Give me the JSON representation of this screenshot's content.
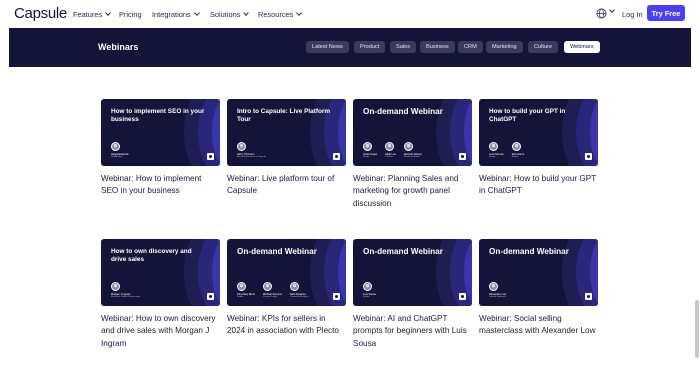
{
  "nav": {
    "logo": "Capsule",
    "items": [
      {
        "label": "Features",
        "dropdown": true
      },
      {
        "label": "Pricing",
        "dropdown": false
      },
      {
        "label": "Integrations",
        "dropdown": true
      },
      {
        "label": "Solutions",
        "dropdown": true
      },
      {
        "label": "Resources",
        "dropdown": true
      }
    ],
    "language_icon": "globe-icon",
    "login": "Log In",
    "cta": "Try Free",
    "cta_color": "#4b3ff0"
  },
  "header": {
    "title": "Webinars",
    "background": "#14143a",
    "categories": [
      {
        "label": "Latest News",
        "active": false
      },
      {
        "label": "Product",
        "active": false
      },
      {
        "label": "Sales",
        "active": false
      },
      {
        "label": "Business",
        "active": false
      },
      {
        "label": "CRM",
        "active": false
      },
      {
        "label": "Marketing",
        "active": false
      },
      {
        "label": "Culture",
        "active": false
      },
      {
        "label": "Webinars",
        "active": true
      }
    ]
  },
  "webinars": [
    {
      "thumb_title": "How to implement SEO in your business",
      "speakers": [
        {
          "name": "Helga Edwards",
          "role": "Studio Host"
        }
      ],
      "caption": "Webinar: How to implement SEO in your business"
    },
    {
      "thumb_title": "Intro to Capsule: Live Platform Tour",
      "speakers": [
        {
          "name": "Harry Thornton",
          "role": "Account Executive at Capsule"
        }
      ],
      "caption": "Webinar: Live platform tour of Capsule"
    },
    {
      "thumb_title": "On-demand Webinar",
      "speakers": [
        {
          "name": "Asher Kogin",
          "role": "Studio"
        },
        {
          "name": "Nikki Lou",
          "role": "Content"
        },
        {
          "name": "Hannah Gibson",
          "role": "Research Author"
        }
      ],
      "caption": "Webinar: Planning Sales and marketing for growth panel discussion"
    },
    {
      "thumb_title": "How to build your GPT in ChatGPT",
      "speakers": [
        {
          "name": "Luis Norman",
          "role": "Studio"
        },
        {
          "name": "Rob Harris",
          "role": "Studio"
        }
      ],
      "caption": "Webinar: How to build your GPT in ChatGPT"
    },
    {
      "thumb_title": "How to own discovery and drive sales",
      "speakers": [
        {
          "name": "Morgan J Ingram",
          "role": "Executive Global Partnerships"
        }
      ],
      "caption": "Webinar: How to own discovery and drive sales with Morgan J Ingram"
    },
    {
      "thumb_title": "On-demand Webinar",
      "speakers": [
        {
          "name": "Penrodey Broni",
          "role": "Studio"
        },
        {
          "name": "Michael Stevens",
          "role": "Content Leads"
        },
        {
          "name": "Rafe Esparza",
          "role": "Customer Analytics"
        }
      ],
      "caption": "Webinar: KPIs for sellers in 2024 in association with Plecto"
    },
    {
      "thumb_title": "On-demand Webinar",
      "speakers": [
        {
          "name": "Luis Sousa",
          "role": "Studio"
        }
      ],
      "caption": "Webinar: AI and ChatGPT prompts for beginners with Luis Sousa"
    },
    {
      "thumb_title": "On-demand Webinar",
      "speakers": [
        {
          "name": "Alexander Low",
          "role": "Growth Strategist"
        }
      ],
      "caption": "Webinar: Social selling masterclass with Alexander Low"
    }
  ]
}
